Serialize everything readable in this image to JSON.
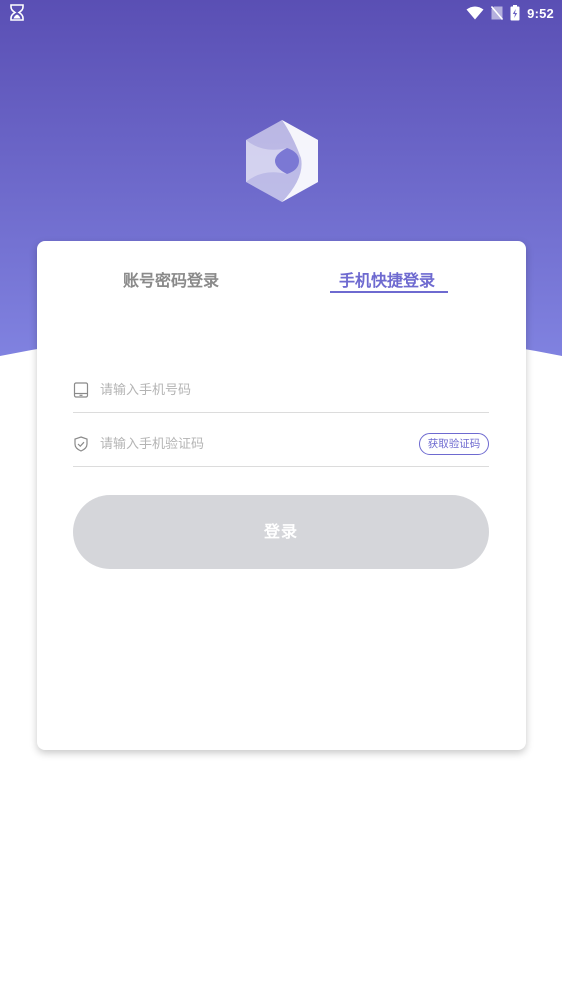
{
  "status_bar": {
    "time": "9:52",
    "left_icon": "hourglass-icon",
    "right_icons": [
      "wifi-icon",
      "no-sim-icon",
      "battery-charging-icon"
    ]
  },
  "logo": {
    "icon": "hexagon-logo-icon"
  },
  "tabs": [
    {
      "label": "账号密码登录",
      "active": false
    },
    {
      "label": "手机快捷登录",
      "active": true
    }
  ],
  "form": {
    "phone": {
      "icon": "phone-icon",
      "placeholder": "请输入手机号码",
      "value": ""
    },
    "code": {
      "icon": "shield-icon",
      "placeholder": "请输入手机验证码",
      "value": "",
      "get_code_label": "获取验证码"
    },
    "login_label": "登录"
  },
  "colors": {
    "header_top": "#5a4fb4",
    "header_bottom": "#8082e0",
    "accent": "#6e6ad0",
    "login_button_disabled": "#d5d6da",
    "tab_inactive": "#8a8a8a"
  }
}
